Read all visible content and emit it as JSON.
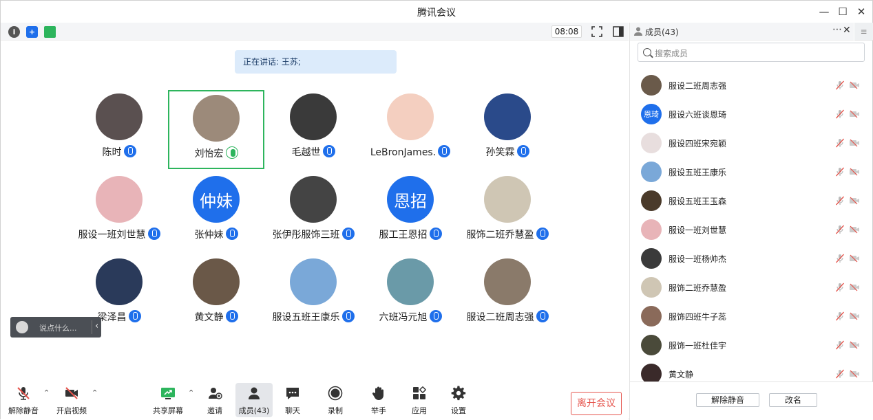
{
  "window": {
    "title": "腾讯会议"
  },
  "topbar": {
    "timer": "08:08"
  },
  "speaking": "正在讲话: 王苏;",
  "participants": [
    {
      "name": "陈时",
      "mic": "active-blue",
      "avatar_color": "#5a5050"
    },
    {
      "name": "刘怡宏",
      "mic": "speaking-green",
      "avatar_color": "#9c8a7a",
      "highlighted": true
    },
    {
      "name": "毛越世",
      "mic": "active-blue",
      "avatar_color": "#3a3a3a"
    },
    {
      "name": "LeBronJames.",
      "mic": "active-blue",
      "avatar_color": "#f4cfc0"
    },
    {
      "name": "孙笑霖",
      "mic": "active-blue",
      "avatar_color": "#2a4a8a"
    },
    {
      "name": "服设一班刘世慧",
      "mic": "active-blue",
      "avatar_color": "#e8b4b8"
    },
    {
      "name": "张仲妹",
      "mic": "active-blue",
      "avatar_color": "#1f6feb",
      "avatar_text": "仲妹"
    },
    {
      "name": "张伊彤服饰三班",
      "mic": "active-blue",
      "avatar_color": "#444444"
    },
    {
      "name": "服工王恩招",
      "mic": "active-blue",
      "avatar_color": "#1f6feb",
      "avatar_text": "恩招"
    },
    {
      "name": "服饰二班乔慧盈",
      "mic": "active-blue",
      "avatar_color": "#cfc6b4"
    },
    {
      "name": "梁泽昌",
      "mic": "active-blue",
      "avatar_color": "#2a3a5a"
    },
    {
      "name": "黄文静",
      "mic": "active-blue",
      "avatar_color": "#6a5848"
    },
    {
      "name": "服设五班王康乐",
      "mic": "active-blue",
      "avatar_color": "#7aa8d8"
    },
    {
      "name": "六班冯元旭",
      "mic": "active-blue",
      "avatar_color": "#6a9aa8"
    },
    {
      "name": "服设二班周志强",
      "mic": "active-blue",
      "avatar_color": "#8a7a6a"
    }
  ],
  "chat_popup": {
    "placeholder": "说点什么..."
  },
  "toolbar": {
    "unmute": "解除静音",
    "start_video": "开启视频",
    "share_screen": "共享屏幕",
    "invite": "邀请",
    "members": "成员(43)",
    "chat": "聊天",
    "record": "录制",
    "raise_hand": "举手",
    "apps": "应用",
    "settings": "设置",
    "leave": "离开会议"
  },
  "panel": {
    "title": "成员(43)",
    "search_placeholder": "搜索成员",
    "members": [
      {
        "name": "服设二班周志强",
        "avatar_color": "#6a5a4a"
      },
      {
        "name": "服设六班谈恩琦",
        "avatar_color": "#1f6feb",
        "avatar_text": "恩琦"
      },
      {
        "name": "服设四班宋宛颖",
        "avatar_color": "#e8dede"
      },
      {
        "name": "服设五班王康乐",
        "avatar_color": "#7aa8d8"
      },
      {
        "name": "服设五班王玉森",
        "avatar_color": "#4a3a2a"
      },
      {
        "name": "服设一班刘世慧",
        "avatar_color": "#e8b4b8"
      },
      {
        "name": "服设一班杨帅杰",
        "avatar_color": "#3a3a3a"
      },
      {
        "name": "服饰二班乔慧盈",
        "avatar_color": "#cfc6b4"
      },
      {
        "name": "服饰四班牛子蕊",
        "avatar_color": "#8a6a5a"
      },
      {
        "name": "服饰一班杜佳宇",
        "avatar_color": "#4a4a3a"
      },
      {
        "name": "黄文静",
        "avatar_color": "#3a2a2a"
      }
    ],
    "unmute_button": "解除静音",
    "rename_button": "改名"
  }
}
